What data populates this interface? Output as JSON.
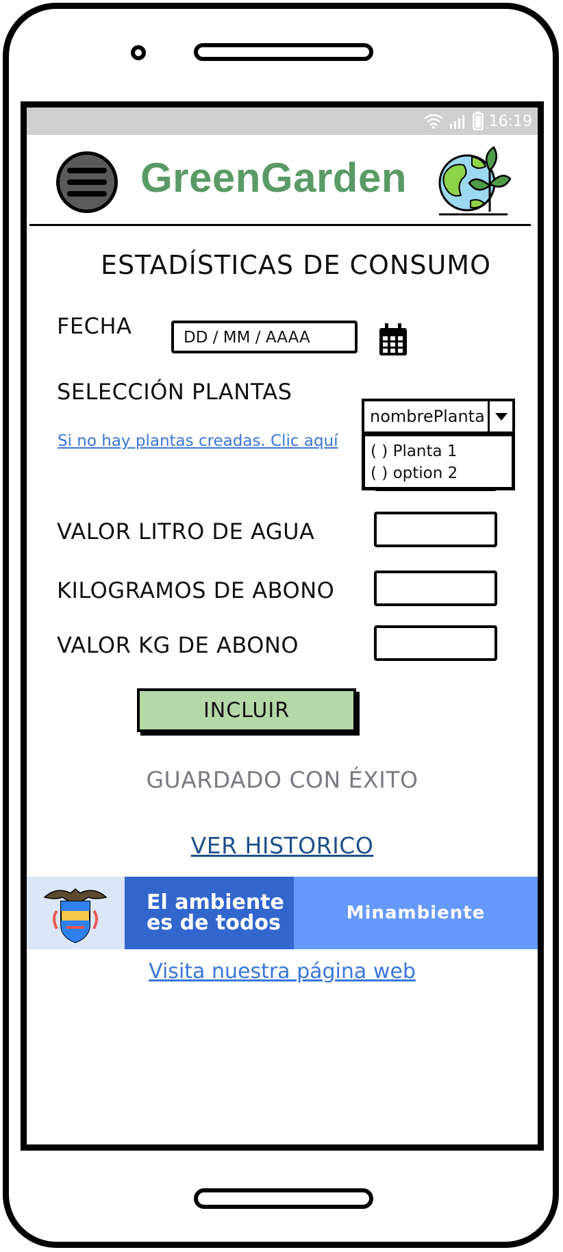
{
  "status_bar": {
    "time": "16:19",
    "icons": [
      "wifi-icon",
      "signal-icon",
      "battery-icon"
    ]
  },
  "header": {
    "title": "GreenGarden",
    "menu_icon": "hamburger-menu-icon",
    "logo_icon": "globe-plant-logo"
  },
  "page": {
    "title": "ESTADÍSTICAS DE CONSUMO"
  },
  "form": {
    "date": {
      "label": "FECHA",
      "placeholder": "DD / MM  / AAAA"
    },
    "plants": {
      "label": "SELECCIÓN PLANTAS",
      "create_link": "Si no hay plantas creadas. Clic aquí",
      "selected": "nombrePlanta",
      "options": [
        "( ) Planta 1",
        "( ) option 2"
      ]
    },
    "water_price": {
      "label": "VALOR LITRO DE AGUA",
      "value": ""
    },
    "fertilizer_kg": {
      "label": "KILOGRAMOS DE ABONO",
      "value": ""
    },
    "fertilizer_price": {
      "label": "VALOR KG DE ABONO",
      "value": ""
    },
    "include_button": "INCLUIR"
  },
  "messages": {
    "saved": "GUARDADO CON ÉXITO"
  },
  "history_link": "VER HISTORICO",
  "banner": {
    "line1": "El ambiente",
    "line2": "es de todos",
    "brand": "Minambiente",
    "colors": {
      "seal_bg": "#dbe6f7",
      "mid_bg": "#3366cc",
      "right_bg": "#6699ff"
    }
  },
  "footer_link": "Visita nuestra página web",
  "colors": {
    "brand_green": "#5a9a66",
    "button_green": "#b5d8a9",
    "link_blue": "#3a76d8"
  }
}
